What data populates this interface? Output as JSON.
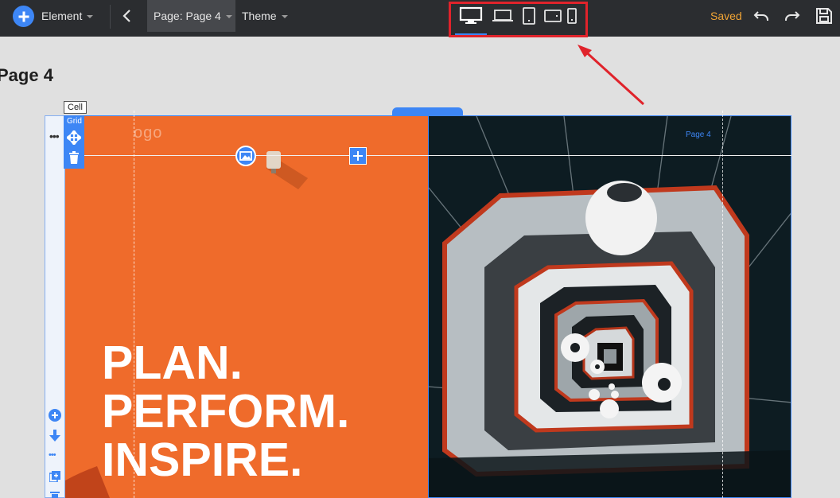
{
  "toolbar": {
    "element_label": "Element",
    "page_selector_label": "Page: Page 4",
    "theme_label": "Theme",
    "saved_status": "Saved",
    "device_icons": [
      "desktop-icon",
      "laptop-icon",
      "tablet-portrait-icon",
      "tablet-landscape-icon",
      "phone-icon"
    ],
    "active_device": "desktop",
    "accent_color": "#3d86f5",
    "saved_color": "#f2a535",
    "highlight_color": "#e0232b"
  },
  "canvas": {
    "page_title": "Page 4",
    "cell_label": "Cell",
    "grid_label": "Grid",
    "logo_text": "ogo",
    "page_link": "Page 4",
    "headline_lines": [
      "PLAN.",
      "PERFORM.",
      "INSPIRE."
    ],
    "left_column_color": "#ef6b2b",
    "right_column_color": "#0d1c22"
  }
}
